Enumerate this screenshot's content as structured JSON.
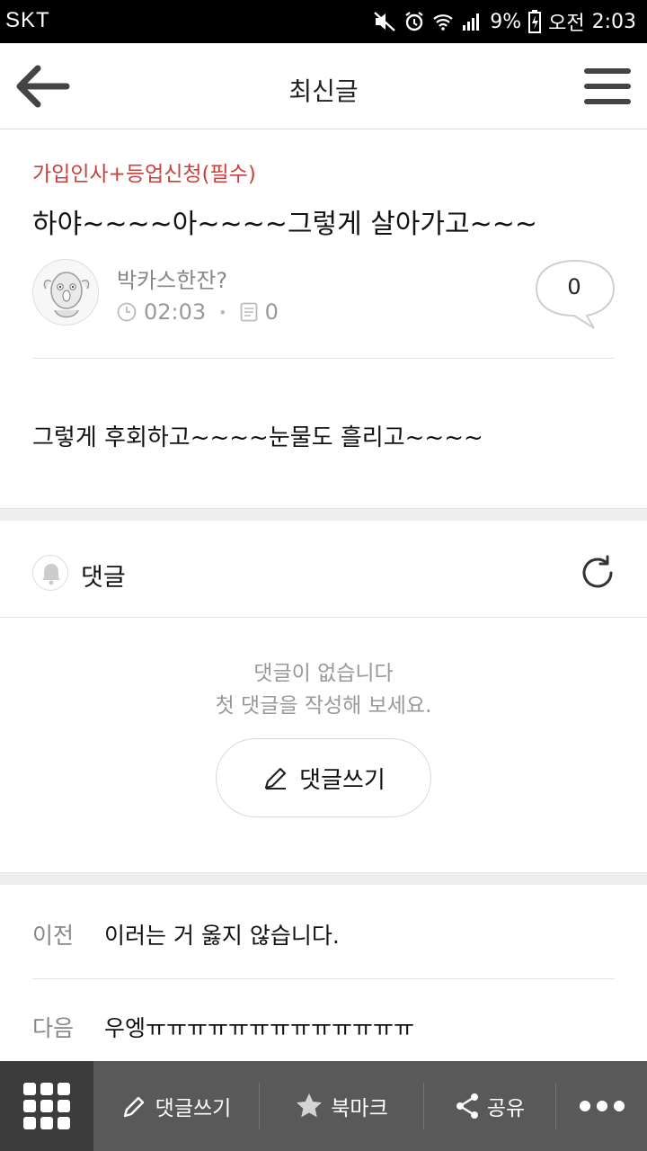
{
  "status_bar": {
    "carrier": "SKT",
    "battery": "9%",
    "ampm": "오전",
    "time": "2:03"
  },
  "header": {
    "title": "최신글",
    "back_icon": "arrow-left-icon",
    "menu_icon": "hamburger-menu-icon"
  },
  "post": {
    "category": "가입인사+등업신청(필수)",
    "title": "하야~~~~아~~~~그렇게 살아가고~~~",
    "author": "박카스한잔?",
    "time": "02:03",
    "views": "0",
    "comment_count": "0",
    "body": "그렇게 후회하고~~~~눈물도 흘리고~~~~"
  },
  "comments": {
    "label": "댓글",
    "empty_line1": "댓글이 없습니다",
    "empty_line2": "첫 댓글을 작성해 보세요.",
    "write_label": "댓글쓰기"
  },
  "navigation": {
    "prev_label": "이전",
    "prev_title": "이러는 거 옳지 않습니다.",
    "next_label": "다음",
    "next_title": "우엥ㅠㅠㅠㅠㅠㅠㅠㅠㅠㅠㅠㅠㅠ"
  },
  "toolbar": {
    "write_label": "댓글쓰기",
    "bookmark_label": "북마크",
    "share_label": "공유"
  },
  "colors": {
    "accent_category": "#c8413e",
    "toolbar_bg": "#595959",
    "toolbar_grid_bg": "#3c3c3c"
  }
}
